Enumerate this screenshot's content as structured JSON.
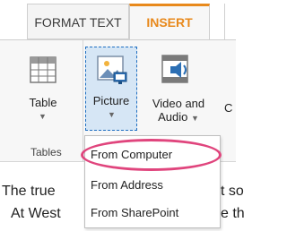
{
  "ribbon": {
    "tabs": [
      {
        "label": "FORMAT TEXT",
        "active": false
      },
      {
        "label": "INSERT",
        "active": true
      }
    ],
    "accent_color": "#e8891c",
    "buttons": {
      "table": {
        "label": "Table",
        "icon": "table-icon"
      },
      "picture": {
        "label": "Picture",
        "icon": "picture-icon"
      },
      "video_audio": {
        "label_line1": "Video and",
        "label_line2": "Audio",
        "icon": "video-audio-icon"
      },
      "partial_next": {
        "label": "C"
      }
    },
    "groups": [
      {
        "label": "Tables"
      }
    ]
  },
  "picture_menu": {
    "items": [
      {
        "label": "From Computer",
        "highlighted": true
      },
      {
        "label": "From Address"
      },
      {
        "label": "From SharePoint"
      }
    ],
    "highlight_color": "#e0457d"
  },
  "document_body": {
    "line1_left": "The true",
    "line1_right": "t so",
    "line2_left": "At West",
    "line2_right": "e th"
  }
}
